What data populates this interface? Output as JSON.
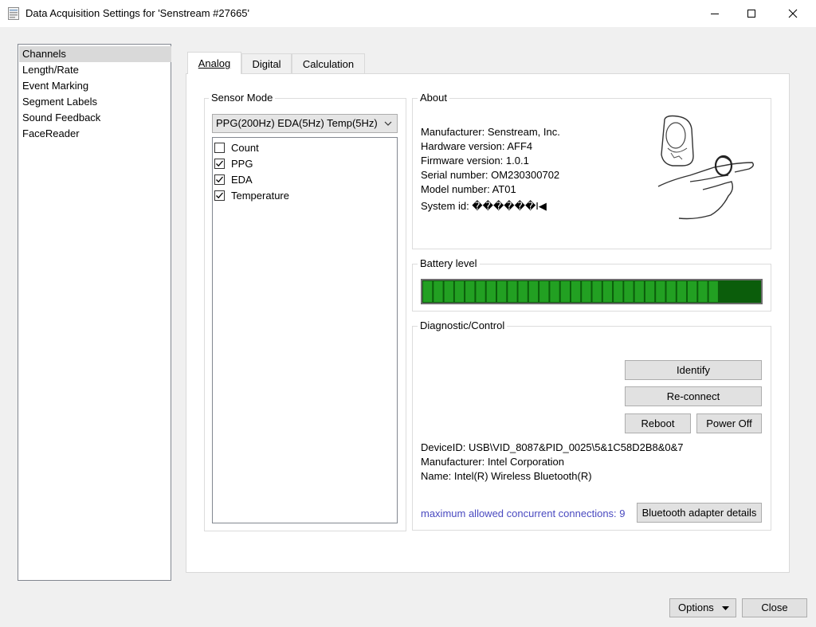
{
  "window": {
    "title": "Data Acquisition Settings for 'Senstream #27665'",
    "minimize_icon": "minimize-icon",
    "maximize_icon": "maximize-icon",
    "close_icon": "close-icon"
  },
  "sidebar": {
    "items": [
      {
        "label": "Channels",
        "selected": true
      },
      {
        "label": "Length/Rate",
        "selected": false
      },
      {
        "label": "Event Marking",
        "selected": false
      },
      {
        "label": "Segment Labels",
        "selected": false
      },
      {
        "label": "Sound Feedback",
        "selected": false
      },
      {
        "label": "FaceReader",
        "selected": false
      }
    ]
  },
  "tabs": {
    "analog": "Analog",
    "digital": "Digital",
    "calculation": "Calculation",
    "active": "Analog"
  },
  "sensor_mode": {
    "label": "Sensor Mode",
    "selected": "PPG(200Hz) EDA(5Hz) Temp(5Hz)",
    "channels": [
      {
        "label": "Count",
        "checked": false
      },
      {
        "label": "PPG",
        "checked": true
      },
      {
        "label": "EDA",
        "checked": true
      },
      {
        "label": "Temperature",
        "checked": true
      }
    ]
  },
  "about": {
    "label": "About",
    "manufacturer": "Manufacturer: Senstream, Inc.",
    "hardware": "Hardware version: AFF4",
    "firmware": "Firmware version: 1.0.1",
    "serial": "Serial number: OM230300702",
    "model": "Model number: AT01",
    "system_id": "System id: ������I◀",
    "device_image": "finger-sensor-illustration"
  },
  "battery": {
    "label": "Battery level",
    "level_fraction": 0.875,
    "segments": 32,
    "fill_color": "#22a022",
    "empty_color": "#0b5d0b"
  },
  "diagnostic": {
    "label": "Diagnostic/Control",
    "identify": "Identify",
    "reconnect": "Re-connect",
    "reboot": "Reboot",
    "power_off": "Power Off",
    "device_id": "DeviceID: USB\\VID_8087&PID_0025\\5&1C58D2B8&0&7",
    "manufacturer": "Manufacturer: Intel Corporation",
    "name": "Name: Intel(R) Wireless Bluetooth(R)",
    "max_connections": "maximum allowed concurrent connections: 9",
    "adapter_details": "Bluetooth adapter details"
  },
  "footer": {
    "options": "Options",
    "close": "Close"
  }
}
